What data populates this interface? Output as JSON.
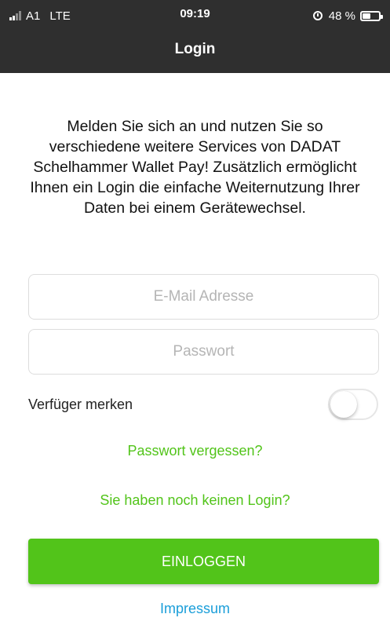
{
  "status_bar": {
    "carrier": "A1",
    "network": "LTE",
    "time": "09:19",
    "battery": "48 %",
    "battery_level": 0.48,
    "icons": [
      "signal-icon",
      "alarm-icon",
      "battery-icon"
    ]
  },
  "nav": {
    "title": "Login"
  },
  "intro_text": "Melden Sie sich an und nutzen Sie so verschiedene weitere Services von DADAT Schelhammer Wallet Pay! Zusätzlich ermöglicht Ihnen ein Login die einfache Weiternutzung Ihrer Daten bei einem Gerätewechsel.",
  "form": {
    "email_placeholder": "E-Mail Adresse",
    "email_value": "",
    "password_placeholder": "Passwort",
    "password_value": "",
    "remember_label": "Verfüger merken",
    "remember_on": false
  },
  "links": {
    "forgot_password": "Passwort vergessen?",
    "no_login": "Sie haben noch keinen Login?",
    "impressum": "Impressum"
  },
  "login_button": "EINLOGGEN",
  "colors": {
    "header_bg": "#2f2f2f",
    "accent_green": "#52c41a",
    "link_blue": "#1a9ed9"
  }
}
